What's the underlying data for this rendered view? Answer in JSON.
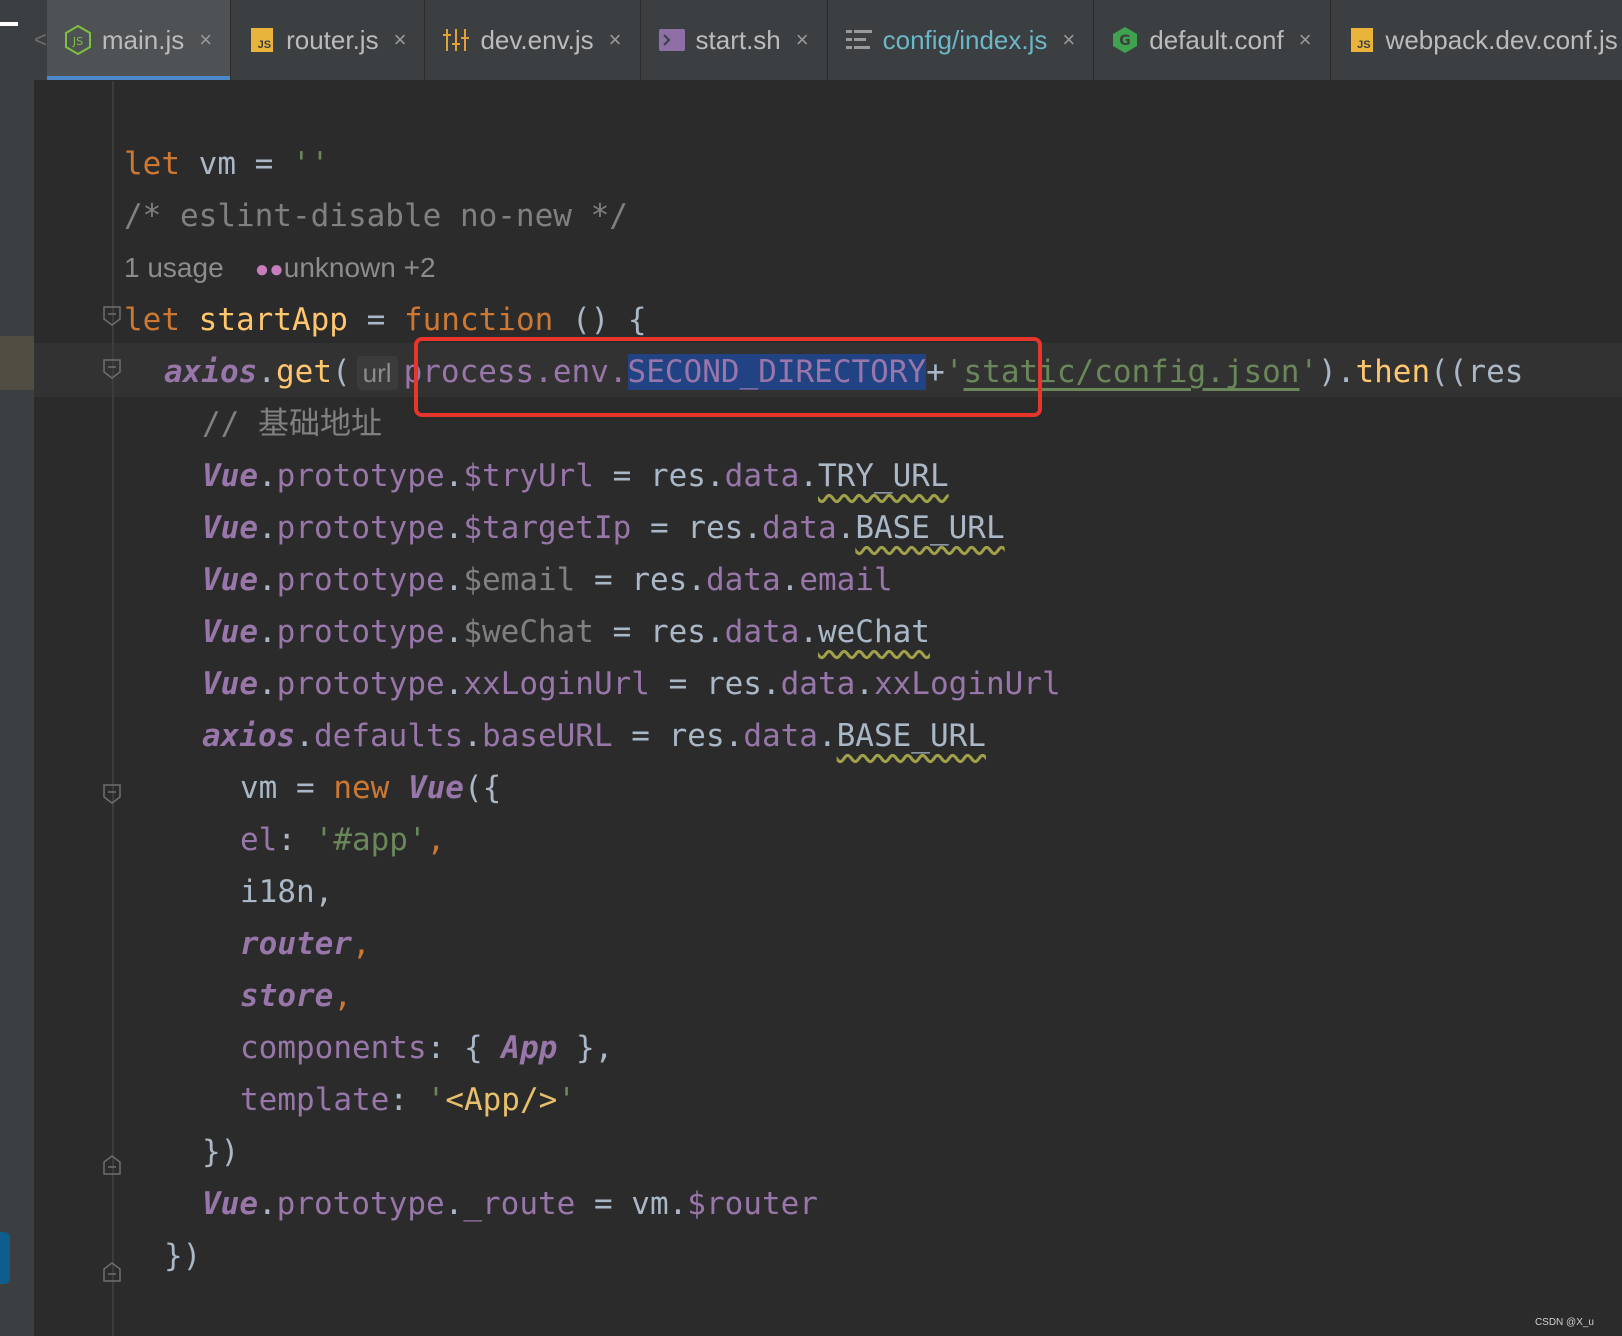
{
  "tabs": [
    {
      "label": "main.js",
      "icon": "nodejs-icon",
      "active": true
    },
    {
      "label": "router.js",
      "icon": "js-file-icon"
    },
    {
      "label": "dev.env.js",
      "icon": "settings-sliders-icon"
    },
    {
      "label": "start.sh",
      "icon": "terminal-icon"
    },
    {
      "label": "config/index.js",
      "icon": "list-icon"
    },
    {
      "label": "default.conf",
      "icon": "nginx-icon"
    },
    {
      "label": "webpack.dev.conf.js",
      "icon": "js-file-icon"
    }
  ],
  "tab_close_glyph": "×",
  "tab_scroll_glyph": "<",
  "js_badge": "JS",
  "usage": {
    "count": "1 usage",
    "authors": "unknown +2"
  },
  "hint_label": "url",
  "colors": {
    "keyword": "#cc7832",
    "function": "#ffc66d",
    "string": "#6a8759",
    "comment": "#808080",
    "property": "#9876aa",
    "text": "#a9b7c6",
    "selection": "#214283",
    "highlight_box": "#e8352b",
    "active_tab_underline": "#4a88c7"
  },
  "code": {
    "line1": {
      "kw": "let",
      "name": " vm = ",
      "str": "''"
    },
    "line2": "/* eslint-disable no-new */",
    "line3": {
      "kw": "let ",
      "fn": "startApp",
      "eq": " = ",
      "kw2": "function",
      "rest": " () {"
    },
    "line4": {
      "obj": "axios",
      "get_prefix": ".",
      "get": "get",
      "paren": "(",
      "process": "process.env.",
      "selected": "SECOND_DIRECTORY",
      "plus": "+",
      "str_q": "'",
      "str_path": "static/config.json",
      "str_q2": "'",
      "then_pre": ").",
      "then": "then",
      "then_post": "((res"
    },
    "line5": "// 基础地址",
    "proto_lines": [
      {
        "lhs_prop": "$tryUrl",
        "rhs_field": "TRY_URL",
        "squiggle": true
      },
      {
        "lhs_prop": "$targetIp",
        "rhs_field": "BASE_URL",
        "squiggle": true
      },
      {
        "lhs_prop": "$email",
        "rhs_field": "email",
        "squiggle": false
      },
      {
        "lhs_prop": "$weChat",
        "rhs_field": "weChat",
        "squiggle": true
      },
      {
        "lhs_prop": "xxLoginUrl",
        "rhs_field": "xxLoginUrl",
        "squiggle": false
      }
    ],
    "vue": "Vue",
    "prototype": "prototype",
    "res": "res",
    "data": "data",
    "axios_defaults": {
      "obj": "axios",
      "defaults": "defaults",
      "baseURL": "baseURL",
      "field": "BASE_URL"
    },
    "vm_new": {
      "vm": "vm = ",
      "new": "new ",
      "vue": "Vue",
      "open": "({"
    },
    "el": {
      "key": "el",
      "colon": ": ",
      "value": "'#app'",
      "comma": ","
    },
    "i18n": "i18n,",
    "router": "router",
    "store": "store",
    "components": {
      "key": "components",
      "open": ": { ",
      "app": "App",
      "close": " },"
    },
    "template": {
      "key": "template",
      "colon": ": ",
      "q": "'",
      "tag": "<App/>",
      "q2": "'"
    },
    "close_vue": "})",
    "route_line": {
      "vue": "Vue",
      "proto": "prototype",
      "prop": "_route",
      "eq": " = vm.",
      "router": "$router"
    },
    "close_then": "})"
  },
  "watermark": "CSDN @X_u"
}
